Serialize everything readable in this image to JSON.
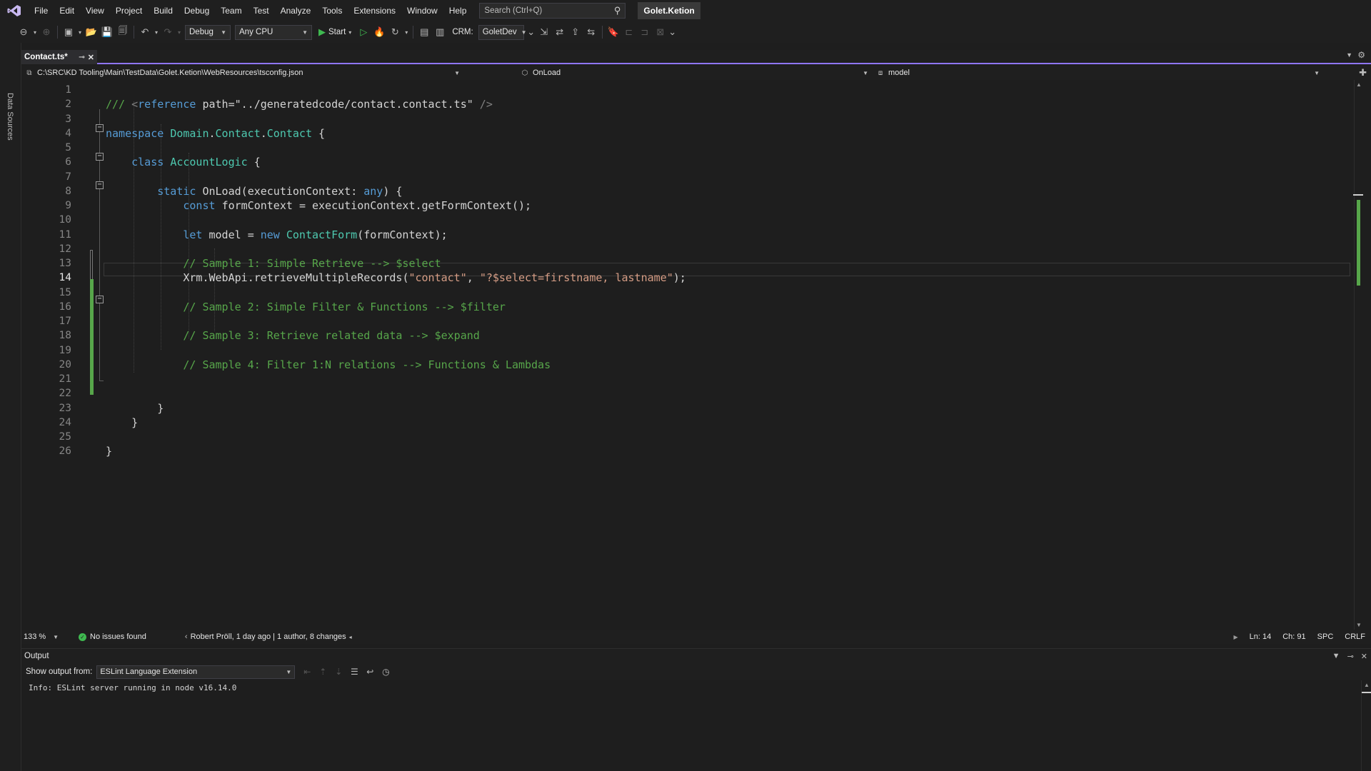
{
  "menu": {
    "items": [
      "File",
      "Edit",
      "View",
      "Project",
      "Build",
      "Debug",
      "Team",
      "Test",
      "Analyze",
      "Tools",
      "Extensions",
      "Window",
      "Help"
    ],
    "search_placeholder": "Search (Ctrl+Q)",
    "solution_name": "Golet.Ketion"
  },
  "toolbar": {
    "config": "Debug",
    "platform": "Any CPU",
    "start_label": "Start",
    "crm_label": "CRM:",
    "crm_env": "GoletDev"
  },
  "side_panel": {
    "data_sources": "Data Sources"
  },
  "tab": {
    "title": "Contact.ts*"
  },
  "navbar": {
    "project": "C:\\SRC\\KD Tooling\\Main\\TestData\\Golet.Ketion\\WebResources\\tsconfig.json",
    "scope": "OnLoad",
    "member": "model"
  },
  "editor": {
    "current_line": 14,
    "lines": [
      {
        "n": "1",
        "text": ""
      },
      {
        "n": "2",
        "text": "/// <reference path=\"../generatedcode/contact.contact.ts\" />"
      },
      {
        "n": "3",
        "text": ""
      },
      {
        "n": "4",
        "text": "namespace Domain.Contact.Contact {"
      },
      {
        "n": "5",
        "text": ""
      },
      {
        "n": "6",
        "text": "    class AccountLogic {"
      },
      {
        "n": "7",
        "text": ""
      },
      {
        "n": "8",
        "text": "        static OnLoad(executionContext: any) {"
      },
      {
        "n": "9",
        "text": "            const formContext = executionContext.getFormContext();"
      },
      {
        "n": "10",
        "text": ""
      },
      {
        "n": "11",
        "text": "            let model = new ContactForm(formContext);"
      },
      {
        "n": "12",
        "text": ""
      },
      {
        "n": "13",
        "text": "            // Sample 1: Simple Retrieve --> $select"
      },
      {
        "n": "14",
        "text": "            Xrm.WebApi.retrieveMultipleRecords(\"contact\", \"?$select=firstname, lastname\");"
      },
      {
        "n": "15",
        "text": ""
      },
      {
        "n": "16",
        "text": "            // Sample 2: Simple Filter & Functions --> $filter"
      },
      {
        "n": "17",
        "text": ""
      },
      {
        "n": "18",
        "text": "            // Sample 3: Retrieve related data --> $expand"
      },
      {
        "n": "19",
        "text": ""
      },
      {
        "n": "20",
        "text": "            // Sample 4: Filter 1:N relations --> Functions & Lambdas"
      },
      {
        "n": "21",
        "text": ""
      },
      {
        "n": "22",
        "text": ""
      },
      {
        "n": "23",
        "text": "        }"
      },
      {
        "n": "24",
        "text": "    }"
      },
      {
        "n": "25",
        "text": ""
      },
      {
        "n": "26",
        "text": "}"
      }
    ]
  },
  "status": {
    "zoom": "133 %",
    "issues": "No issues found",
    "git": "Robert Pröll, 1 day ago | 1 author, 8 changes",
    "line": "Ln: 14",
    "col": "Ch: 91",
    "spacing": "SPC",
    "eol": "CRLF"
  },
  "output": {
    "title": "Output",
    "show_from_label": "Show output from:",
    "source": "ESLint Language Extension",
    "text": "Info: ESLint server running in node v16.14.0"
  },
  "colors": {
    "accent": "#8f76ff",
    "change_marker": "#57a64a",
    "comment": "#57a64a",
    "keyword": "#569cd6",
    "type": "#4ec9b0",
    "string": "#d69d85"
  }
}
